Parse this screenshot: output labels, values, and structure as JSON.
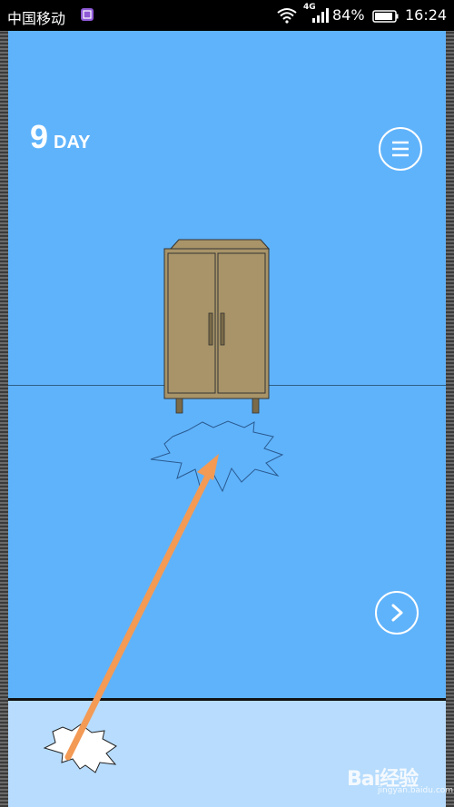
{
  "status_bar": {
    "carrier": "中国移动",
    "network": "4G",
    "battery": "84%",
    "time": "16:24",
    "icons": [
      "notification-icon",
      "wifi-icon",
      "signal-icon",
      "battery-icon"
    ]
  },
  "game": {
    "day_number": "9",
    "day_label": "DAY",
    "menu_icon": "hamburger-menu-icon",
    "next_icon": "chevron-right-icon",
    "scene_objects": [
      "wooden-cabinet",
      "cracked-hole-outline"
    ],
    "inventory_items": [
      "cracked-hole-piece"
    ],
    "annotation": "orange-arrow"
  },
  "watermark": {
    "brand": "Bai经验",
    "subtitle": "jingyan.baidu.com"
  },
  "colors": {
    "wall": "#5fb3fb",
    "tray": "#b7dcfd",
    "cabinet": "#a89468",
    "arrow": "#f39a55"
  }
}
